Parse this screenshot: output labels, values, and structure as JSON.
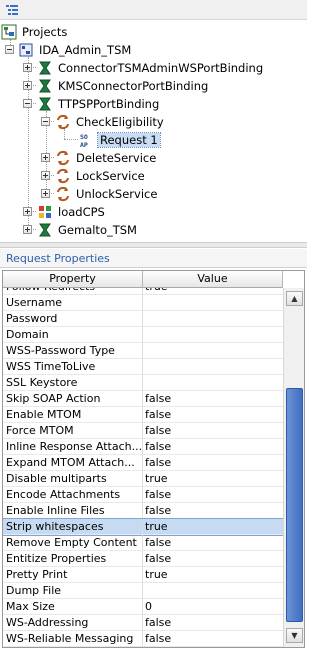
{
  "toolbar": {
    "icon": "tree-view-icon"
  },
  "tree": {
    "root": "Projects",
    "project": "IDA_Admin_TSM",
    "bindings": [
      {
        "label": "ConnectorTSMAdminWSPortBinding",
        "icon": "interface-icon"
      },
      {
        "label": "KMSConnectorPortBinding",
        "icon": "interface-icon"
      },
      {
        "label": "TTPSPPortBinding",
        "icon": "interface-icon"
      }
    ],
    "operation": "CheckEligibility",
    "request": "Request 1",
    "operations": [
      {
        "label": "DeleteService"
      },
      {
        "label": "LockService"
      },
      {
        "label": "UnlockService"
      }
    ],
    "others": [
      {
        "label": "loadCPS",
        "icon": "testsuite-icon"
      },
      {
        "label": "Gemalto_TSM",
        "icon": "interface-icon"
      }
    ]
  },
  "panel": {
    "title": "Request Properties",
    "columns": {
      "property": "Property",
      "value": "Value"
    },
    "rows": [
      {
        "name": "Follow Redirects",
        "value": "true"
      },
      {
        "name": "Username",
        "value": ""
      },
      {
        "name": "Password",
        "value": ""
      },
      {
        "name": "Domain",
        "value": ""
      },
      {
        "name": "WSS-Password Type",
        "value": ""
      },
      {
        "name": "WSS TimeToLive",
        "value": ""
      },
      {
        "name": "SSL Keystore",
        "value": ""
      },
      {
        "name": "Skip SOAP Action",
        "value": "false"
      },
      {
        "name": "Enable MTOM",
        "value": "false"
      },
      {
        "name": "Force MTOM",
        "value": "false"
      },
      {
        "name": "Inline Response Attach...",
        "value": "false"
      },
      {
        "name": "Expand MTOM Attach...",
        "value": "false"
      },
      {
        "name": "Disable multiparts",
        "value": "true"
      },
      {
        "name": "Encode Attachments",
        "value": "false"
      },
      {
        "name": "Enable Inline Files",
        "value": "false"
      },
      {
        "name": "Strip whitespaces",
        "value": "true",
        "selected": true
      },
      {
        "name": "Remove Empty Content",
        "value": "false"
      },
      {
        "name": "Entitize Properties",
        "value": "false"
      },
      {
        "name": "Pretty Print",
        "value": "true"
      },
      {
        "name": "Dump File",
        "value": ""
      },
      {
        "name": "Max Size",
        "value": "0"
      },
      {
        "name": "WS-Addressing",
        "value": "false"
      },
      {
        "name": "WS-Reliable Messaging",
        "value": "false"
      }
    ],
    "scroll_up_glyph": "▲",
    "scroll_down_glyph": "▼"
  }
}
